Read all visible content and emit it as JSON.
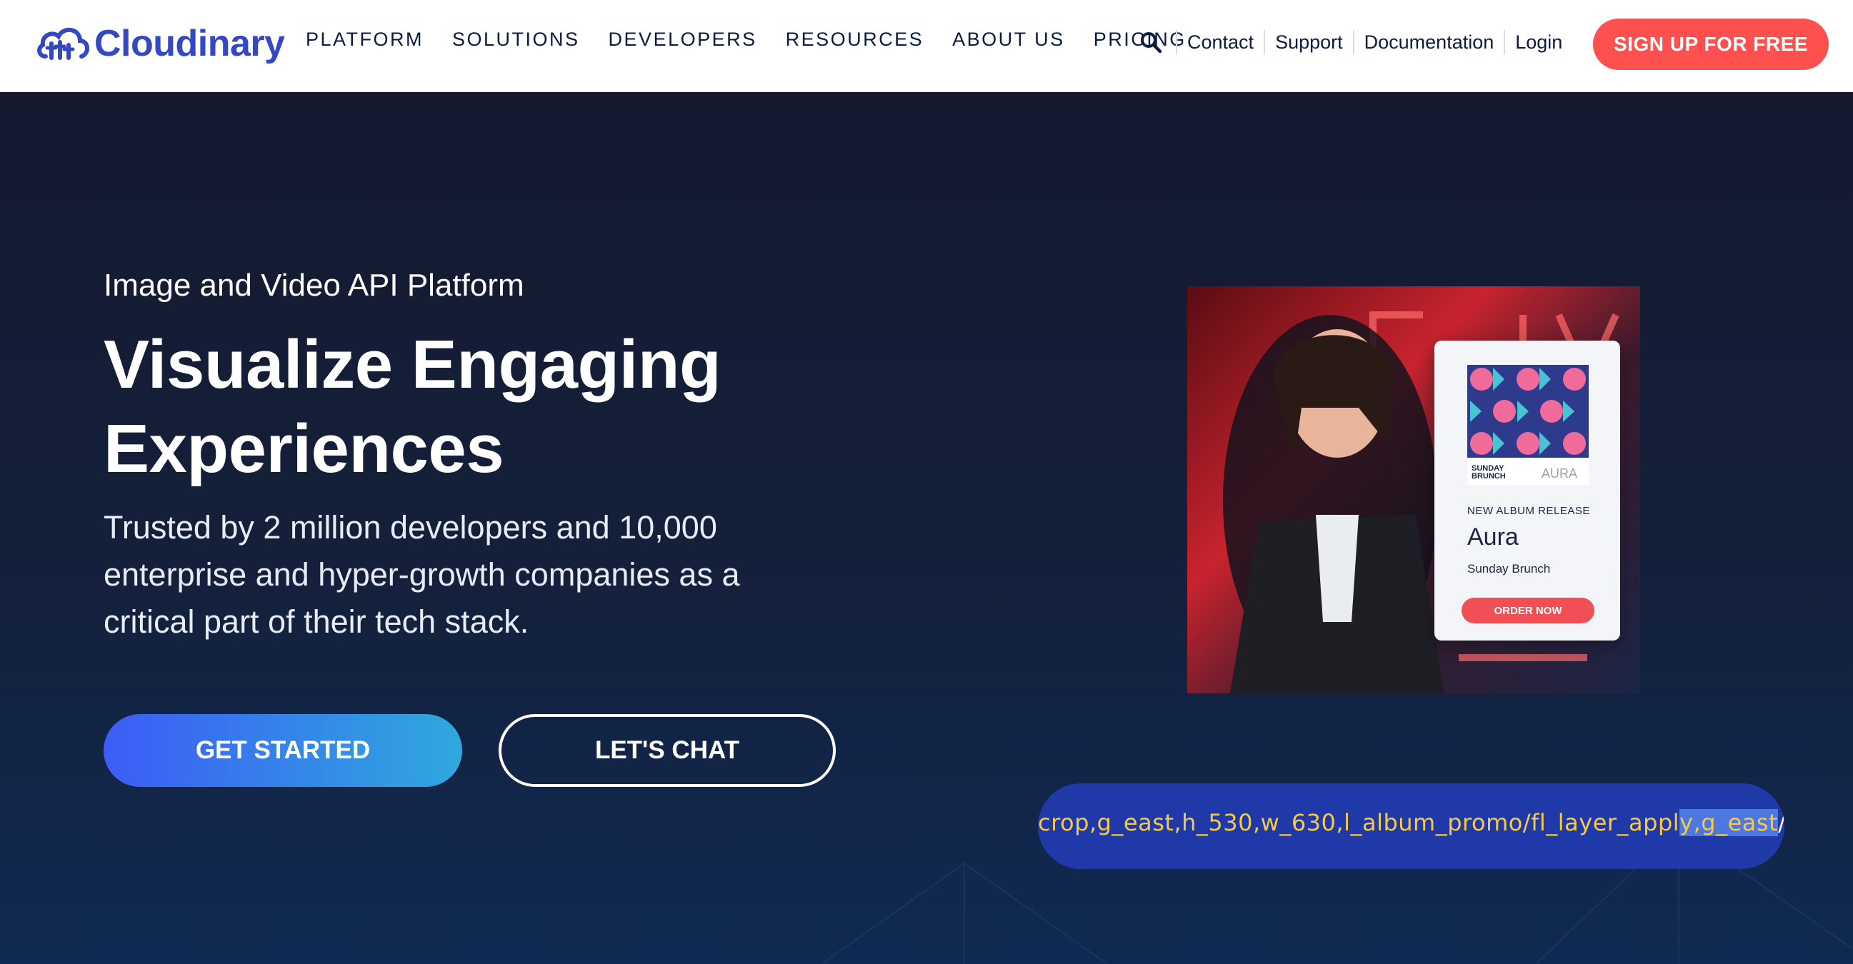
{
  "header": {
    "logo_text": "Cloudinary",
    "nav": [
      "PLATFORM",
      "SOLUTIONS",
      "DEVELOPERS",
      "RESOURCES",
      "ABOUT US",
      "PRICING"
    ],
    "utility_links": [
      "Contact",
      "Support",
      "Documentation",
      "Login"
    ],
    "signup_label": "SIGN UP FOR FREE"
  },
  "hero": {
    "eyebrow": "Image and Video API Platform",
    "headline": "Visualize Engaging Experiences",
    "description": "Trusted by 2 million developers and 10,000 enterprise and hyper-growth companies as a critical part of their tech stack.",
    "cta_primary": "GET STARTED",
    "cta_secondary": "LET'S CHAT"
  },
  "promo": {
    "art_tag": "SUNDAY BRUNCH",
    "art_label": "AURA",
    "small_label": "NEW ALBUM RELEASE",
    "title": "Aura",
    "subtitle": "Sunday Brunch",
    "button": "ORDER NOW"
  },
  "url_bar": {
    "before": "crop,g_east,h_530,w_630,l_album_promo/fl_layer_appl",
    "highlight": "y,g_east",
    "after": "/ad"
  },
  "colors": {
    "brand": "#3448c5",
    "signup": "#ff5050",
    "hero_bg": "#141a2e",
    "url_text": "#f7c948"
  }
}
